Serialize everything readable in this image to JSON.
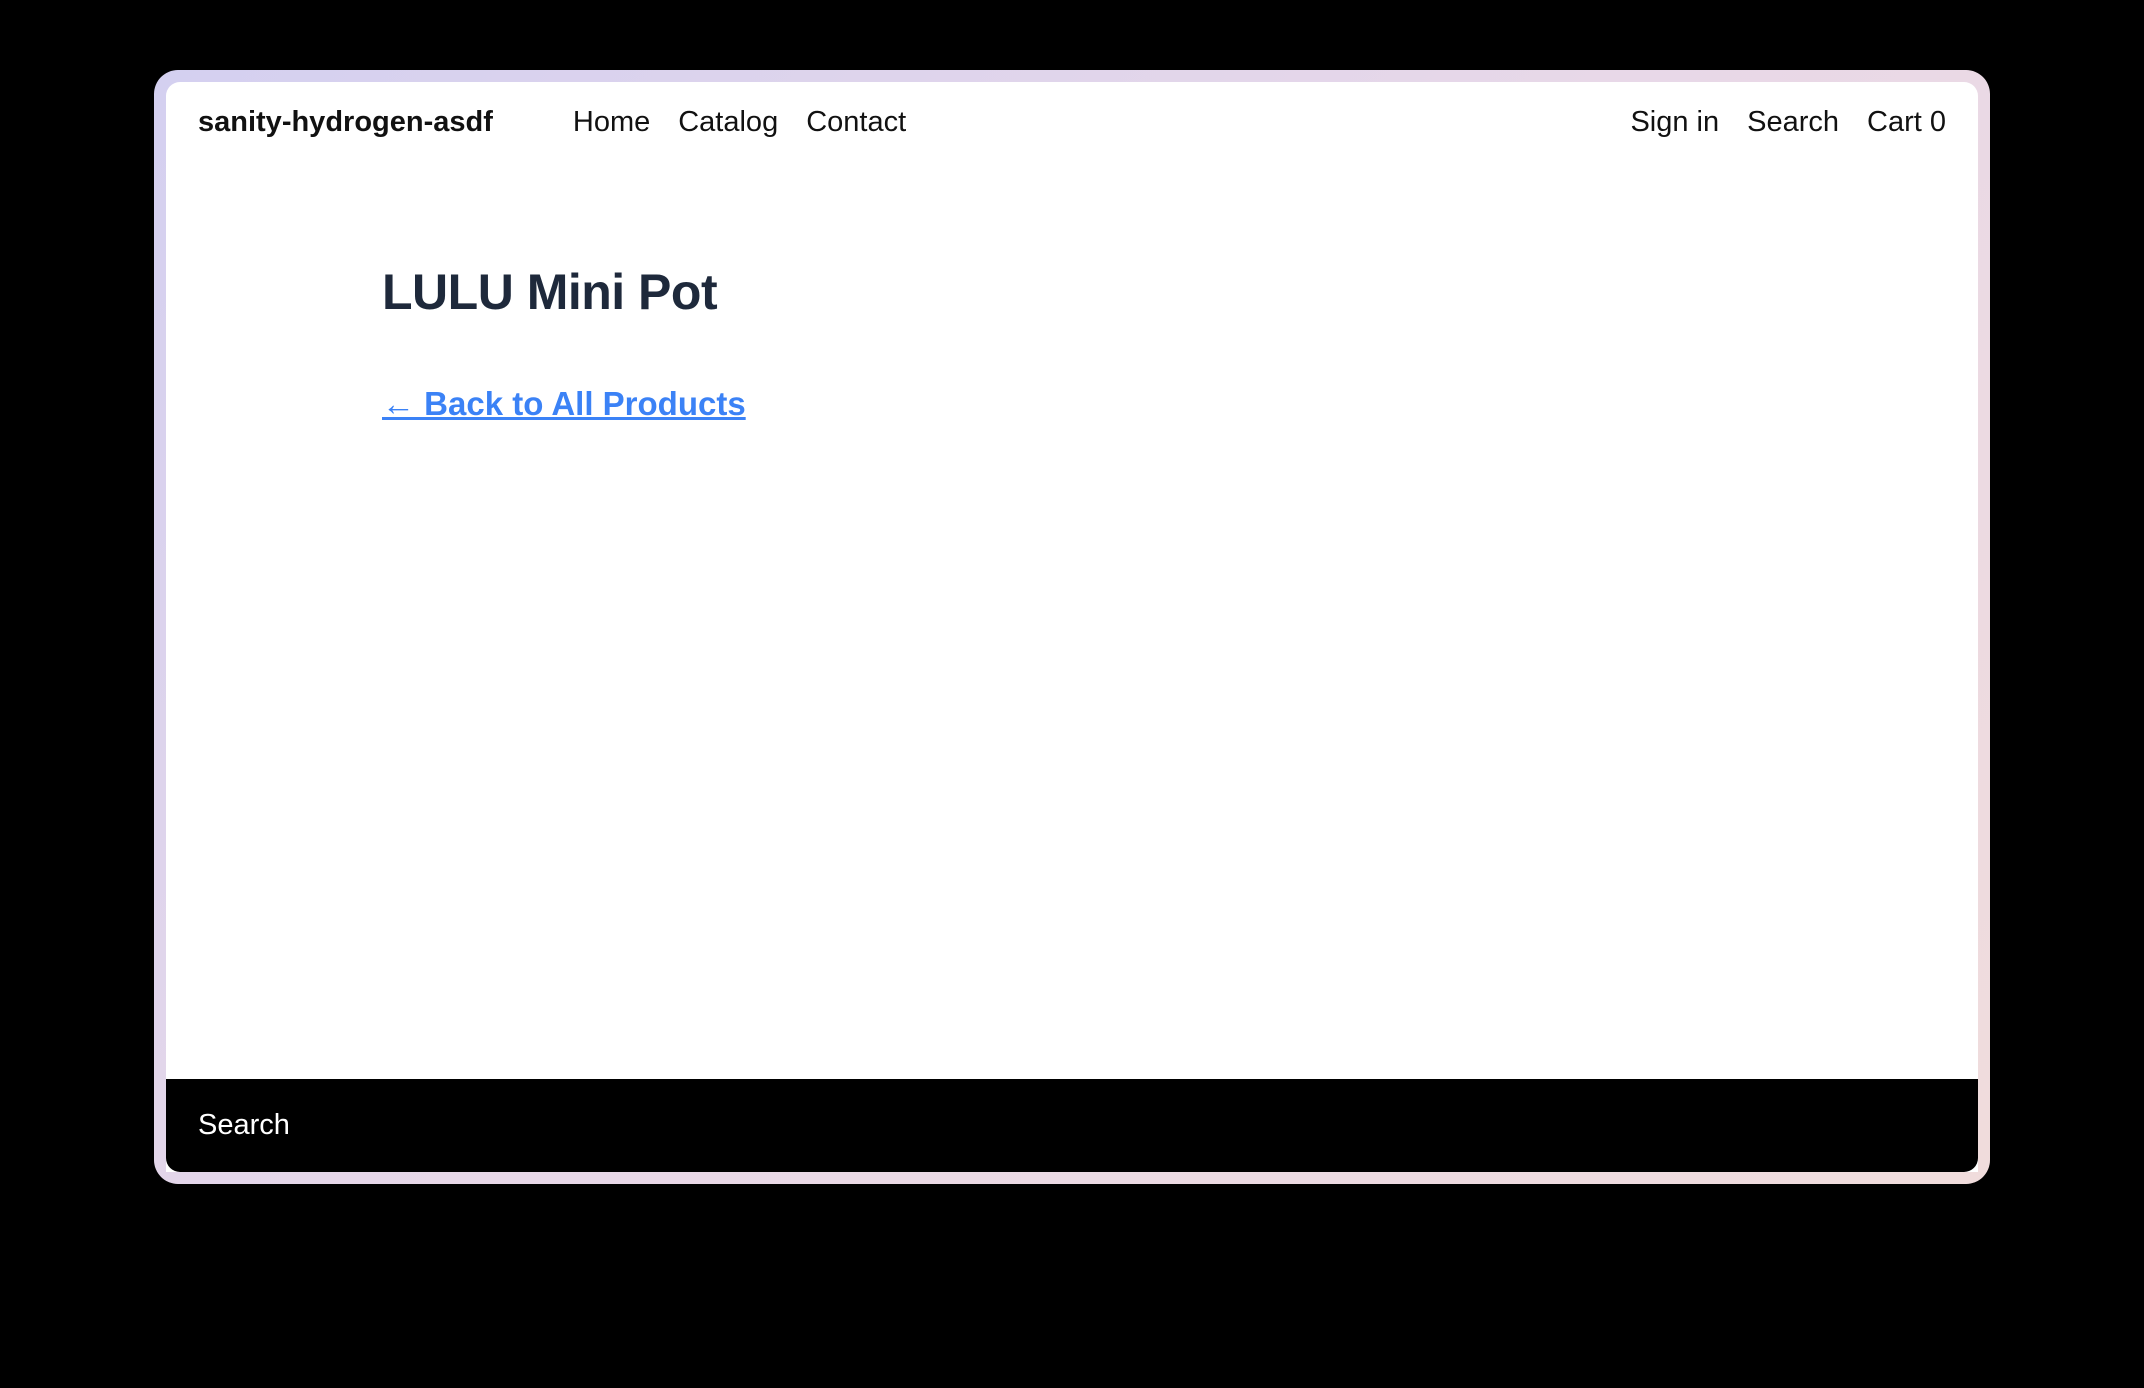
{
  "header": {
    "site_title": "sanity-hydrogen-asdf",
    "nav": {
      "home": "Home",
      "catalog": "Catalog",
      "contact": "Contact"
    },
    "right": {
      "signin": "Sign in",
      "search": "Search",
      "cart_label": "Cart ",
      "cart_count": "0"
    }
  },
  "main": {
    "product_title": "LULU Mini Pot",
    "back_link": "← Back to All Products"
  },
  "footer": {
    "search": "Search"
  }
}
